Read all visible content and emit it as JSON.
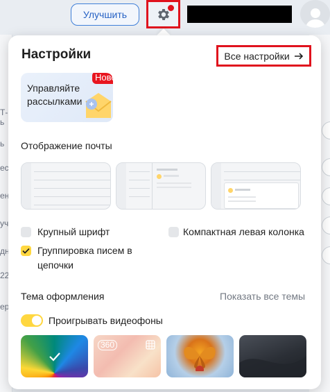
{
  "header": {
    "upgrade_label": "Улучшить",
    "settings_icon": "gear-icon",
    "notification_color": "#e0121d",
    "avatar_icon": "user-avatar-icon"
  },
  "panel": {
    "title": "Настройки",
    "all_settings_label": "Все настройки",
    "all_settings_icon": "arrow-right-icon",
    "promo": {
      "text": "Управляйте рассылками",
      "badge": "Новое",
      "icon": "envelope-icon"
    },
    "mail_display": {
      "label": "Отображение почты",
      "layouts": [
        "list-layout",
        "two-pane-layout",
        "three-pane-layout"
      ]
    },
    "options": [
      {
        "label": "Крупный шрифт",
        "checked": false
      },
      {
        "label": "Компактная левая колонка",
        "checked": false
      },
      {
        "label": "Группировка писем в цепочки",
        "checked": true
      }
    ],
    "theme": {
      "label": "Тема оформления",
      "show_all_label": "Показать все темы",
      "video_toggle_label": "Проигрывать видеофоны",
      "video_toggle_on": true,
      "thumbnails": [
        {
          "name": "colorful-fan-theme",
          "selected": true
        },
        {
          "name": "360-theme",
          "badge": "360"
        },
        {
          "name": "butterfly-theme"
        },
        {
          "name": "dark-theme"
        }
      ]
    }
  },
  "colors": {
    "accent_yellow": "#ffd740",
    "brand_blue": "#2561c4"
  }
}
